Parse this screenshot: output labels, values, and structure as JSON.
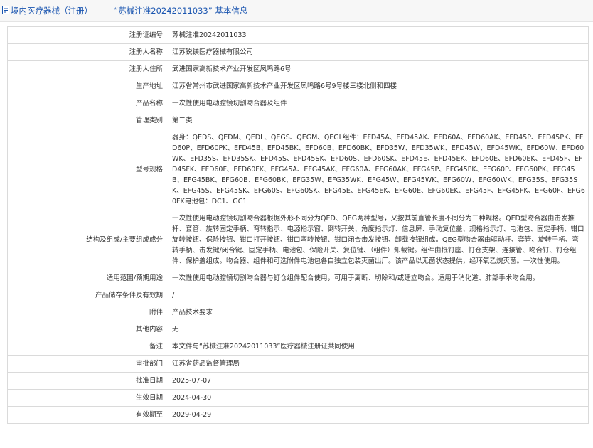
{
  "header": {
    "title": "境内医疗器械（注册） —— “苏械注准20242011033” 基本信息"
  },
  "rows": [
    {
      "label": "注册证编号",
      "value": "苏械注准20242011033"
    },
    {
      "label": "注册人名称",
      "value": "江苏锐镁医疗器械有限公司"
    },
    {
      "label": "注册人住所",
      "value": "武进国家高新技术产业开发区凤鸣路6号"
    },
    {
      "label": "生产地址",
      "value": "江苏省常州市武进国家高新技术产业开发区凤鸣路6号9号楼三楼北侧和四楼"
    },
    {
      "label": "产品名称",
      "value": "一次性使用电动腔镜切割吻合器及组件"
    },
    {
      "label": "管理类别",
      "value": "第二类"
    },
    {
      "label": "型号规格",
      "value": "器身：QEDS、QEDM、QEDL、QEGS、QEGM、QEGL组件：EFD45A、EFD45AK、EFD60A、EFD60AK、EFD45P、EFD45PK、EFD60P、EFD60PK、EFD45B、EFD45BK、EFD60B、EFD60BK、EFD35W、EFD35WK、EFD45W、EFD45WK、EFD60W、EFD60WK、EFD35S、EFD35SK、EFD45S、EFD45SK、EFD60S、EFD60SK、EFD45E、EFD45EK、EFD60E、EFD60EK、EFD45F、EFD45FK、EFD60F、EFD60FK、EFG45A、EFG45AK、EFG60A、EFG60AK、EFG45P、EFG45PK、EFG60P、EFG60PK、EFG45B、EFG45BK、EFG60B、EFG60BK、EFG35W、EFG35WK、EFG45W、EFG45WK、EFG60W、EFG60WK、EFG35S、EFG35SK、EFG45S、EFG45SK、EFG60S、EFG60SK、EFG45E、EFG45EK、EFG60E、EFG60EK、EFG45F、EFG45FK、EFG60F、EFG60FK电池包：DC1、GC1"
    },
    {
      "label": "结构及组成/主要组成成分",
      "value": "一次性使用电动腔镜切割吻合器根据外形不同分为QED、QEG两种型号，又按其前直管长度不同分为三种规格。QED型吻合器由击发推杆、套管、旋转固定手柄、弯转指示、电源指示窗、倒转开关、角度指示灯、信息屏、手动复位盖、规格指示灯、电池包、固定手柄、钳口旋转按钮、保险按钮、钳口打开按钮、钳口弯转按钮、钳口闭合击发按钮、卸载按钮组成。QEG型吻合器由驱动杆、套管、旋转手柄、弯转手柄、击发键/闭合键、固定手柄、电池包、保险开关、复位键、（组件）卸载键。组件由抵钉座、钉仓支架、连接管、吻合钉、钉仓组件、保护盖组成。吻合器、组件和可选附件电池包各自独立包装灭菌出厂。该产品以无菌状态提供，经环氧乙烷灭菌。一次性使用。"
    },
    {
      "label": "适用范围/预期用途",
      "value": "一次性使用电动腔镜切割吻合器与钉仓组件配合使用，可用于离断、切除和/或建立吻合。适用于消化道、肺部手术吻合用。"
    },
    {
      "label": "产品储存条件及有效期",
      "value": "/"
    },
    {
      "label": "附件",
      "value": "产品技术要求"
    },
    {
      "label": "其他内容",
      "value": "无"
    },
    {
      "label": "备注",
      "value": "本文件与“苏械注准20242011033”医疗器械注册证共同使用"
    },
    {
      "label": "审批部门",
      "value": "江苏省药品监督管理局"
    },
    {
      "label": "批准日期",
      "value": "2025-07-07"
    },
    {
      "label": "生效日期",
      "value": "2024-04-30"
    },
    {
      "label": "有效期至",
      "value": "2029-04-29"
    }
  ]
}
